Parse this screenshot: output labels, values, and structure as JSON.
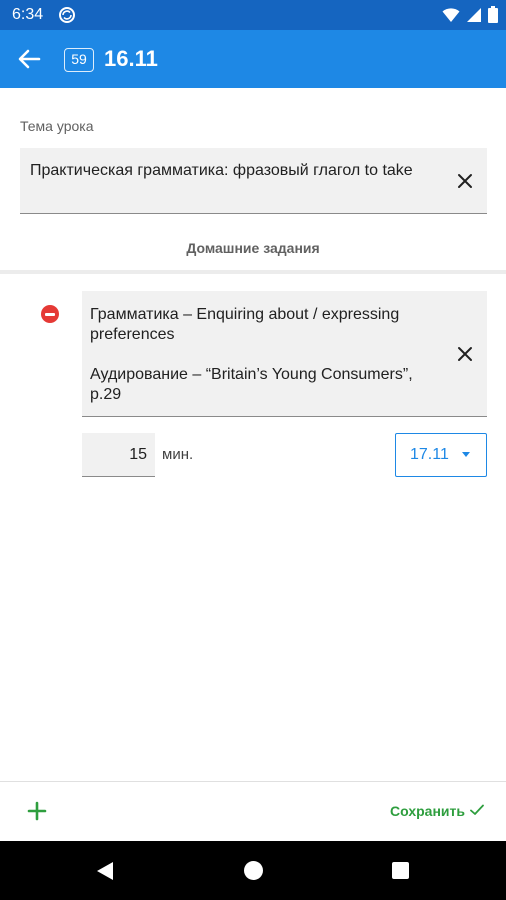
{
  "status_bar": {
    "time": "6:34",
    "icons": [
      "sync-icon",
      "wifi-icon",
      "signal-icon",
      "battery-icon"
    ]
  },
  "app_bar": {
    "lesson_number": "59",
    "title": "16.11",
    "color": "#1e88e5"
  },
  "topic": {
    "label": "Тема урока",
    "value": "Практическая грамматика: фразовый глагол  to take"
  },
  "homework": {
    "header": "Домашние задания",
    "items": [
      {
        "lines": [
          "Грамматика – Enquiring about / expressing preferences",
          "Аудирование – “Britain’s Young Consumers”, p.29"
        ],
        "minutes": "15",
        "minutes_unit": "мин.",
        "due_date": "17.11"
      }
    ]
  },
  "bottom_bar": {
    "add_icon": "plus-icon",
    "save_label": "Сохранить",
    "save_color": "#2e9e3e"
  },
  "nav_bar": {
    "icons": [
      "back-triangle-icon",
      "home-circle-icon",
      "recent-square-icon"
    ]
  }
}
